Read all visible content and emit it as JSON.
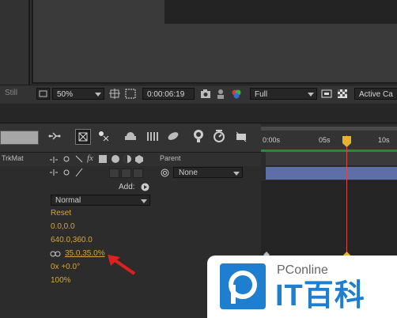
{
  "viewer": {
    "still_label": "Still",
    "zoom": "50%",
    "timecode": "0:00:06:19",
    "resolution": "Full",
    "camera": "Active Ca"
  },
  "timeline": {
    "columns": {
      "trkmat": "TrkMat",
      "parent": "Parent"
    },
    "parent_value": "None",
    "add_label": "Add:",
    "blend_mode": "Normal",
    "props": {
      "reset": "Reset",
      "anchor": "0.0,0.0",
      "position": "640.0,360.0",
      "scale": "35.0,35.0%",
      "rotation": "0x +0.0°",
      "opacity": "100%"
    },
    "ruler": {
      "t0": "0:00s",
      "t5": "05s",
      "t10": "10s"
    }
  },
  "watermark": {
    "brand": "PConline",
    "name": "IT百科"
  },
  "colors": {
    "value": "#d5a43a",
    "playhead": "#d84a4a",
    "layer_bar": "#5d6ea8",
    "arrow": "#e02020",
    "brand_blue": "#1e7fd0"
  }
}
